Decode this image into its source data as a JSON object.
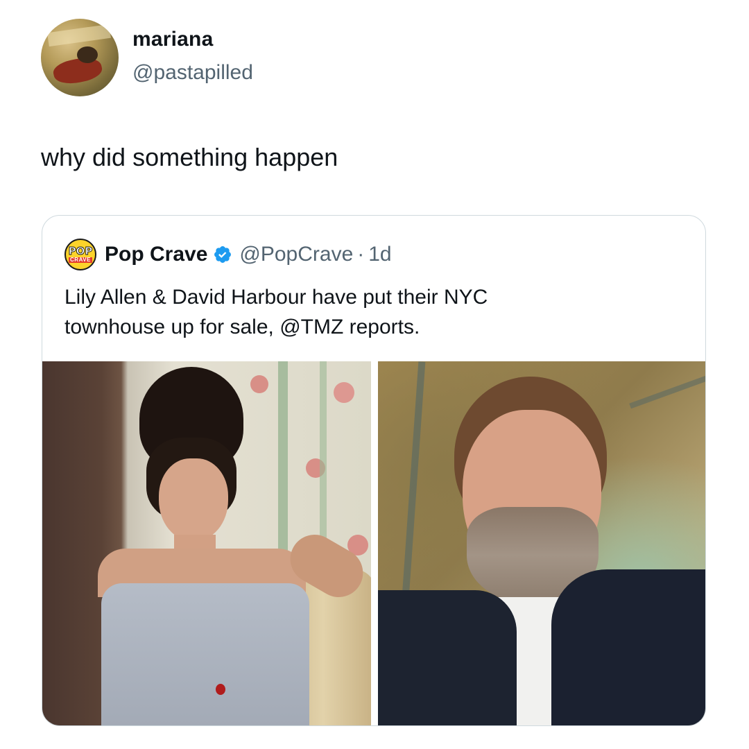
{
  "tweet": {
    "display_name": "mariana",
    "handle": "@pastapilled",
    "text": "why did something happen",
    "avatar_icon": "avatar-photo"
  },
  "quote": {
    "logo_top": "POP",
    "logo_bottom": "CRAVE",
    "display_name": "Pop Crave",
    "verified_icon": "verified-badge-icon",
    "handle": "@PopCrave",
    "separator": "·",
    "time": "1d",
    "text_lines": [
      "Lily Allen & David Harbour have put their NYC",
      "townhouse up for sale, @TMZ reports."
    ],
    "images": [
      "photo-lily-allen",
      "photo-david-harbour"
    ]
  },
  "colors": {
    "primary_text": "#0f1419",
    "secondary_text": "#536471",
    "border": "#cfd9de",
    "verified_blue": "#1d9bf0"
  }
}
